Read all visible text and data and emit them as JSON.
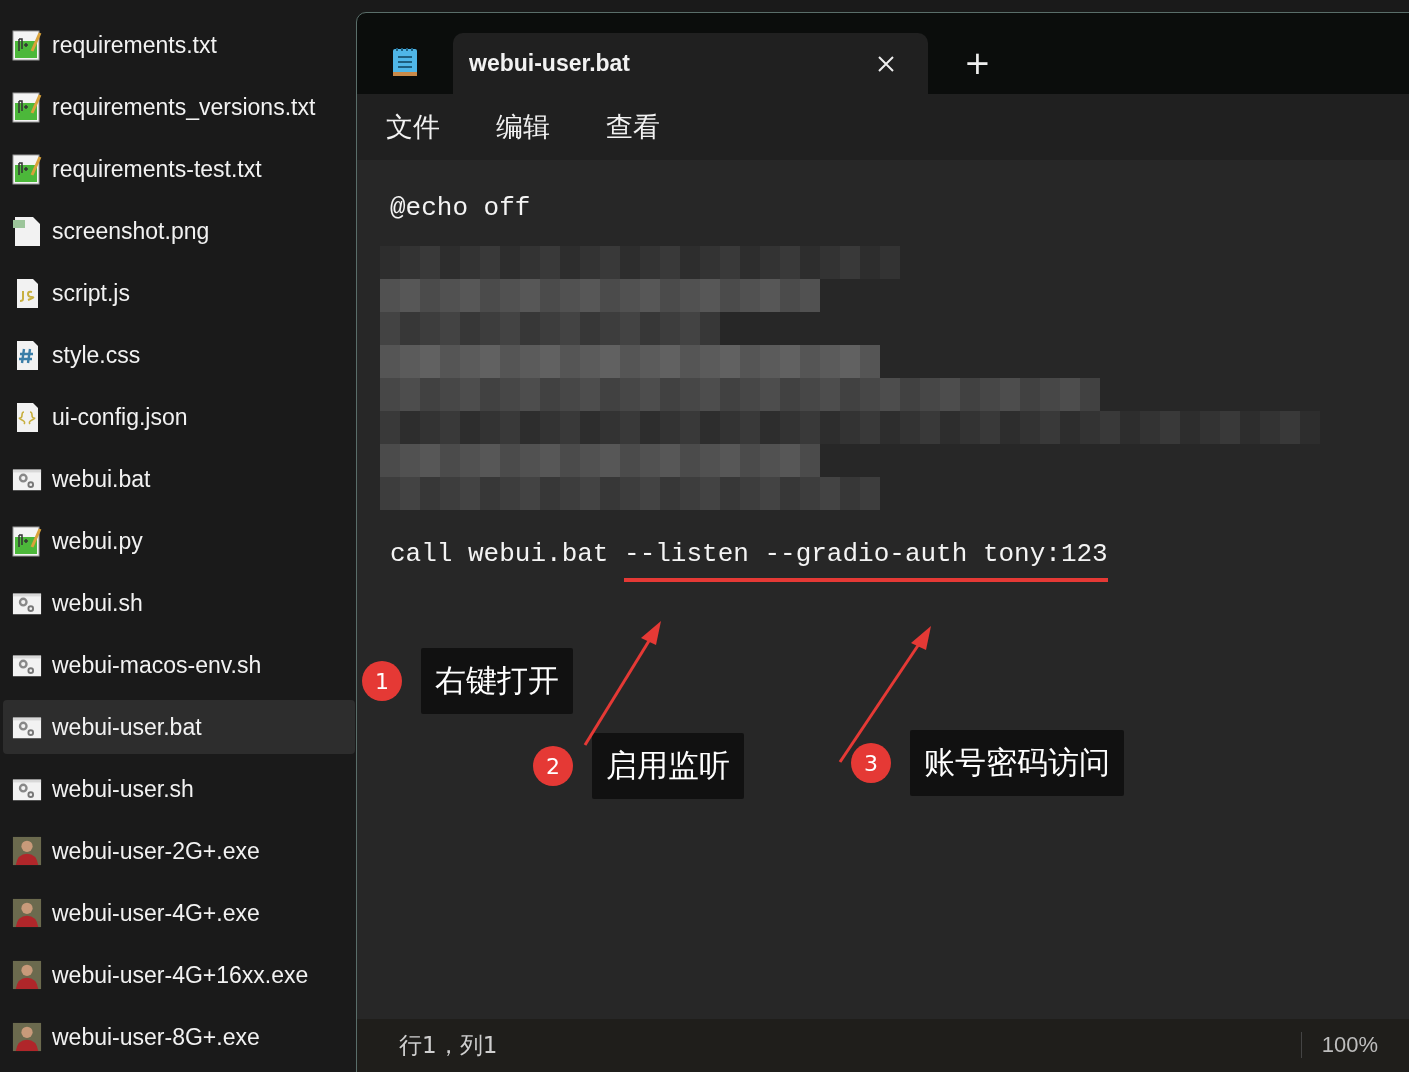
{
  "files": [
    {
      "name": "requirements.txt",
      "kind": "notepad",
      "selected": false
    },
    {
      "name": "requirements_versions.txt",
      "kind": "notepad",
      "selected": false
    },
    {
      "name": "requirements-test.txt",
      "kind": "notepad",
      "selected": false
    },
    {
      "name": "screenshot.png",
      "kind": "image",
      "selected": false
    },
    {
      "name": "script.js",
      "kind": "js",
      "selected": false
    },
    {
      "name": "style.css",
      "kind": "css",
      "selected": false
    },
    {
      "name": "ui-config.json",
      "kind": "json",
      "selected": false
    },
    {
      "name": "webui.bat",
      "kind": "script",
      "selected": false
    },
    {
      "name": "webui.py",
      "kind": "notepad",
      "selected": false
    },
    {
      "name": "webui.sh",
      "kind": "script",
      "selected": false
    },
    {
      "name": "webui-macos-env.sh",
      "kind": "script",
      "selected": false
    },
    {
      "name": "webui-user.bat",
      "kind": "script",
      "selected": true
    },
    {
      "name": "webui-user.sh",
      "kind": "script",
      "selected": false
    },
    {
      "name": "webui-user-2G+.exe",
      "kind": "exe",
      "selected": false
    },
    {
      "name": "webui-user-4G+.exe",
      "kind": "exe",
      "selected": false
    },
    {
      "name": "webui-user-4G+16xx.exe",
      "kind": "exe",
      "selected": false
    },
    {
      "name": "webui-user-8G+.exe",
      "kind": "exe",
      "selected": false
    }
  ],
  "notepad": {
    "tab": {
      "title": "webui-user.bat"
    },
    "new_tab": "+",
    "menu": [
      "文件",
      "编辑",
      "查看"
    ],
    "lines": [
      {
        "kind": "code",
        "text": "@echo off"
      },
      {
        "kind": "redacted"
      },
      {
        "kind": "code",
        "text": "call webui.bat --listen --gradio-auth tony:123"
      }
    ],
    "status": {
      "position": "行1，列1",
      "zoom": "100%"
    }
  },
  "callouts": [
    {
      "number": "1",
      "text": "右键打开"
    },
    {
      "number": "2",
      "text": "启用监听"
    },
    {
      "number": "3",
      "text": "账号密码访问"
    }
  ]
}
